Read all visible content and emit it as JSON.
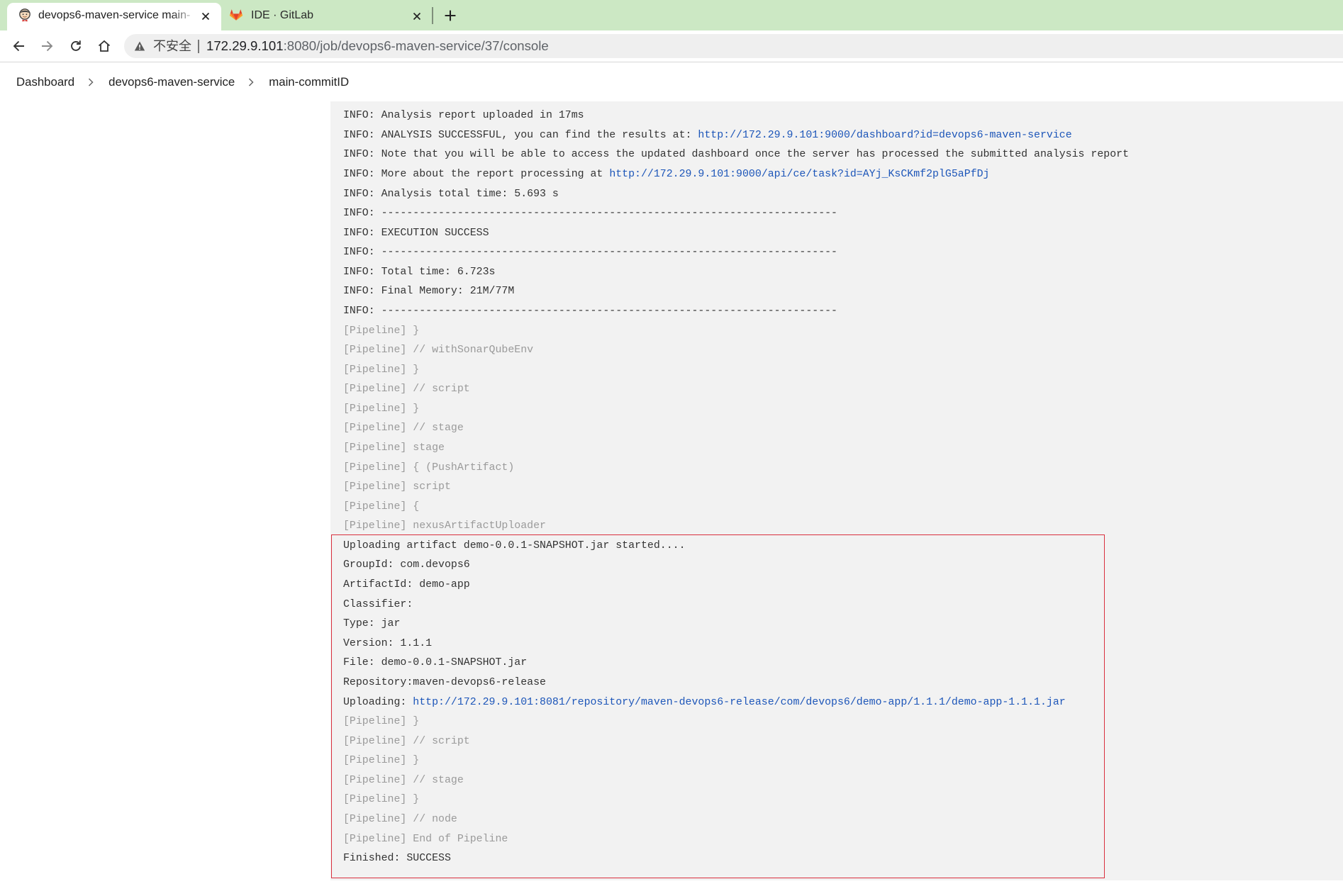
{
  "browser": {
    "tabs": [
      {
        "title": "devops6-maven-service main-",
        "icon": "jenkins-icon",
        "active": true
      },
      {
        "title": "IDE · GitLab",
        "icon": "gitlab-icon",
        "active": false
      }
    ],
    "tab_close_icon": "close-icon",
    "new_tab_icon": "plus-icon",
    "nav_icons": [
      "back-arrow-icon",
      "forward-arrow-icon",
      "reload-icon",
      "home-icon"
    ],
    "security_icon": "warning-triangle-icon",
    "security_label": "不安全",
    "url_host": "172.29.9.101",
    "url_path": ":8080/job/devops6-maven-service/37/console"
  },
  "breadcrumb": {
    "items": [
      "Dashboard",
      "devops6-maven-service",
      "main-commitID"
    ],
    "separator_icon": "chevron-right-icon"
  },
  "console": {
    "lines": [
      {
        "text": "INFO: Analysis report uploaded in 17ms"
      },
      {
        "text": "INFO: ANALYSIS SUCCESSFUL, you can find the results at: ",
        "link": "http://172.29.9.101:9000/dashboard?id=devops6-maven-service"
      },
      {
        "text": "INFO: Note that you will be able to access the updated dashboard once the server has processed the submitted analysis report"
      },
      {
        "text": "INFO: More about the report processing at ",
        "link": "http://172.29.9.101:9000/api/ce/task?id=AYj_KsCKmf2plG5aPfDj"
      },
      {
        "text": "INFO: Analysis total time: 5.693 s"
      },
      {
        "text": "INFO: ------------------------------------------------------------------------"
      },
      {
        "text": "INFO: EXECUTION SUCCESS"
      },
      {
        "text": "INFO: ------------------------------------------------------------------------"
      },
      {
        "text": "INFO: Total time: 6.723s"
      },
      {
        "text": "INFO: Final Memory: 21M/77M"
      },
      {
        "text": "INFO: ------------------------------------------------------------------------"
      },
      {
        "text": "[Pipeline] }"
      },
      {
        "text": "[Pipeline] // withSonarQubeEnv"
      },
      {
        "text": "[Pipeline] }"
      },
      {
        "text": "[Pipeline] // script"
      },
      {
        "text": "[Pipeline] }"
      },
      {
        "text": "[Pipeline] // stage"
      },
      {
        "text": "[Pipeline] stage"
      },
      {
        "text": "[Pipeline] { (PushArtifact)"
      },
      {
        "text": "[Pipeline] script"
      },
      {
        "text": "[Pipeline] {"
      },
      {
        "text": "[Pipeline] nexusArtifactUploader"
      },
      {
        "text": "Uploading artifact demo-0.0.1-SNAPSHOT.jar started...."
      },
      {
        "text": "GroupId: com.devops6"
      },
      {
        "text": "ArtifactId: demo-app"
      },
      {
        "text": "Classifier:"
      },
      {
        "text": "Type: jar"
      },
      {
        "text": "Version: 1.1.1"
      },
      {
        "text": "File: demo-0.0.1-SNAPSHOT.jar"
      },
      {
        "text": "Repository:maven-devops6-release"
      },
      {
        "text": "Uploading: ",
        "link": "http://172.29.9.101:8081/repository/maven-devops6-release/com/devops6/demo-app/1.1.1/demo-app-1.1.1.jar"
      },
      {
        "text": "[Pipeline] }"
      },
      {
        "text": "[Pipeline] // script"
      },
      {
        "text": "[Pipeline] }"
      },
      {
        "text": "[Pipeline] // stage"
      },
      {
        "text": "[Pipeline] }"
      },
      {
        "text": "[Pipeline] // node"
      },
      {
        "text": "[Pipeline] End of Pipeline"
      },
      {
        "text": "Finished: SUCCESS"
      }
    ]
  },
  "colors": {
    "tab_strip": "#cce8c4",
    "console_bg": "#f2f2f2",
    "console_text": "#333333",
    "pipeline_text": "#9a9a9a",
    "link": "#1d56b9",
    "highlight_border": "#d9303e"
  }
}
